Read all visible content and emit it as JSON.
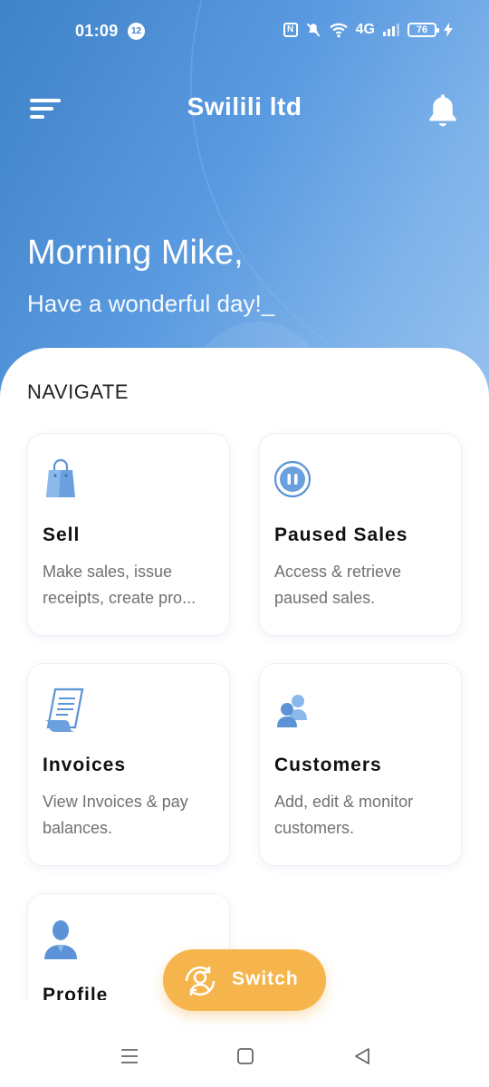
{
  "status_bar": {
    "time": "01:09",
    "notification_count": "12",
    "nfc_label": "N",
    "network": "4G",
    "battery": "76"
  },
  "header": {
    "title": "Swilili ltd",
    "menu_icon": "hamburger-menu-icon",
    "bell_icon": "bell-icon"
  },
  "greeting": {
    "line1": "Morning Mike,",
    "line2": "Have a wonderful day!_"
  },
  "navigate": {
    "section_title": "NAVIGATE",
    "cards": [
      {
        "title": "Sell",
        "description": "Make sales, issue receipts, create pro...",
        "icon": "shopping-bag-icon"
      },
      {
        "title": "Paused Sales",
        "description": "Access & retrieve paused sales.",
        "icon": "pause-circle-icon"
      },
      {
        "title": "Invoices",
        "description": "View Invoices & pay balances.",
        "icon": "invoice-icon"
      },
      {
        "title": "Customers",
        "description": "Add, edit & monitor customers.",
        "icon": "customers-icon"
      },
      {
        "title": "Profile",
        "description": "",
        "icon": "profile-icon"
      }
    ]
  },
  "fab": {
    "label": "Switch",
    "icon": "switch-user-icon"
  },
  "colors": {
    "header_gradient_start": "#3f82c8",
    "header_gradient_end": "#97c2ef",
    "icon_blue": "#5b93d6",
    "fab_orange": "#f6b54c"
  }
}
